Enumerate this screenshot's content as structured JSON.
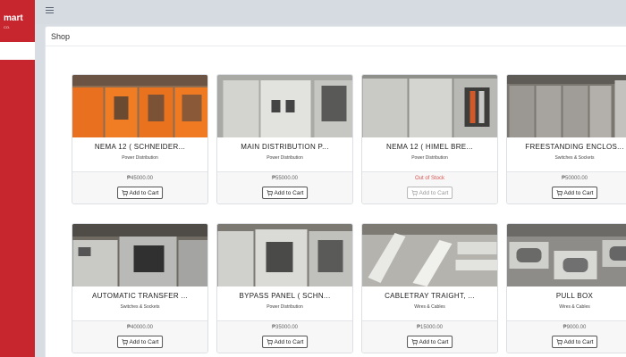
{
  "app": {
    "brand_name": "mart",
    "brand_sub": "CO."
  },
  "header": {
    "page_title": "Shop"
  },
  "icons": {
    "menu": "hamburger-icon",
    "cart": "cart-icon"
  },
  "colors": {
    "sidebar": "#c8262e",
    "out_of_stock": "#d9534f"
  },
  "products": [
    {
      "title": "NEMA 12 ( SCHNEIDER...",
      "category": "Power Distribution",
      "price": "₱45000.00",
      "button": "Add to Cart",
      "in_stock": true
    },
    {
      "title": "MAIN DISTRIBUTION P...",
      "category": "Power Distribution",
      "price": "₱55000.00",
      "button": "Add to Cart",
      "in_stock": true
    },
    {
      "title": "NEMA 12 ( HIMEL BRE...",
      "category": "Power Distribution",
      "price": "Out of Stock",
      "button": "Add to Cart",
      "in_stock": false
    },
    {
      "title": "FREESTANDING ENCLOS...",
      "category": "Switches & Sockets",
      "price": "₱50000.00",
      "button": "Add to Cart",
      "in_stock": true
    },
    {
      "title": "AUTOMATIC TRANSFER ...",
      "category": "Switches & Sockets",
      "price": "₱40000.00",
      "button": "Add to Cart",
      "in_stock": true
    },
    {
      "title": "BYPASS PANEL ( SCHN...",
      "category": "Power Distribution",
      "price": "₱35000.00",
      "button": "Add to Cart",
      "in_stock": true
    },
    {
      "title": "CABLETRAY TRAIGHT, ...",
      "category": "Wires & Cables",
      "price": "₱15000.00",
      "button": "Add to Cart",
      "in_stock": true
    },
    {
      "title": "PULL BOX",
      "category": "Wires & Cables",
      "price": "₱9000.00",
      "button": "Add to Cart",
      "in_stock": true
    }
  ]
}
